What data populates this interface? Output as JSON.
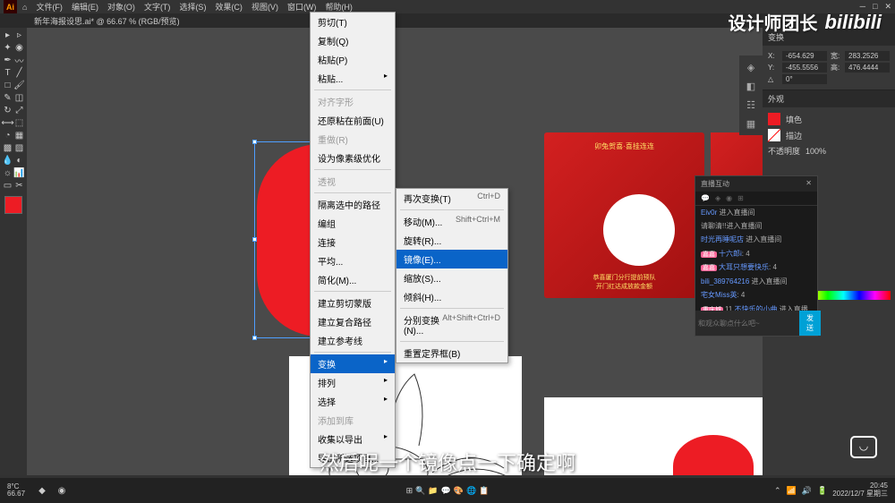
{
  "topbar": {
    "menus": [
      "文件(F)",
      "编辑(E)",
      "对象(O)",
      "文字(T)",
      "选择(S)",
      "效果(C)",
      "视图(V)",
      "窗口(W)",
      "帮助(H)"
    ]
  },
  "tab": {
    "title": "新年海报设思.ai* @ 66.67 % (RGB/预览)"
  },
  "watermark": {
    "text": "设计师团长",
    "logo": "bilibili"
  },
  "context_menu": {
    "items": [
      {
        "label": "剪切(T)"
      },
      {
        "label": "复制(Q)"
      },
      {
        "label": "粘贴(P)"
      },
      {
        "label": "粘贴...",
        "arrow": true
      },
      {
        "sep": true
      },
      {
        "label": "对齐字形",
        "disabled": true
      },
      {
        "label": "还原粘在前面(U)"
      },
      {
        "label": "重做(R)",
        "disabled": true
      },
      {
        "label": "设为像素级优化"
      },
      {
        "sep": true
      },
      {
        "label": "透视",
        "disabled": true
      },
      {
        "sep": true
      },
      {
        "label": "隔离选中的路径"
      },
      {
        "label": "编组"
      },
      {
        "label": "连接"
      },
      {
        "label": "平均..."
      },
      {
        "label": "简化(M)..."
      },
      {
        "sep": true
      },
      {
        "label": "建立剪切蒙版"
      },
      {
        "label": "建立复合路径"
      },
      {
        "label": "建立参考线"
      },
      {
        "sep": true
      },
      {
        "label": "变换",
        "arrow": true,
        "highlight": true
      },
      {
        "label": "排列",
        "arrow": true
      },
      {
        "label": "选择",
        "arrow": true
      },
      {
        "label": "添加到库",
        "disabled": true
      },
      {
        "label": "收集以导出",
        "arrow": true
      },
      {
        "label": "导出所选项目..."
      }
    ]
  },
  "submenu": {
    "items": [
      {
        "label": "再次变换(T)",
        "shortcut": "Ctrl+D"
      },
      {
        "sep": true
      },
      {
        "label": "移动(M)...",
        "shortcut": "Shift+Ctrl+M"
      },
      {
        "label": "旋转(R)..."
      },
      {
        "label": "镜像(E)...",
        "highlight": true
      },
      {
        "label": "缩放(S)..."
      },
      {
        "label": "倾斜(H)..."
      },
      {
        "sep": true
      },
      {
        "label": "分别变换(N)...",
        "shortcut": "Alt+Shift+Ctrl+D"
      },
      {
        "sep": true
      },
      {
        "label": "重置定界框(B)"
      }
    ]
  },
  "transform": {
    "title": "变换",
    "x": "-654.629",
    "y": "283.2526",
    "w": "-455.5556",
    "h": "476.4444",
    "angle": "0°"
  },
  "appearance": {
    "title": "外观",
    "fill": "填色",
    "stroke": "描边",
    "opacity_label": "不透明度",
    "opacity_value": "100%"
  },
  "livechat": {
    "title": "直播互动",
    "msg1_user": "Eiv0r",
    "msg1_text": "进入直播间",
    "msg2": "请聊清!!进入直播间",
    "msg3_user": "时光再睡呢店",
    "msg3_text": "进入直播间",
    "msg4_user": "十六郎i",
    "msg4_badge": "嘉嘉",
    "msg4_text": "4",
    "msg5_user": "大耳只想要快乐",
    "msg5_badge": "嘉嘉",
    "msg5_text": "4",
    "msg6_user": "bili_389764216",
    "msg6_text": "进入直播间",
    "msg7_user": "宅女Miss英",
    "msg7_text": "4",
    "msg8_badge": "重庆城",
    "msg8_num": "11",
    "msg8_user": "不快乐的小曲",
    "msg8_text": "进入直播间",
    "placeholder": "和观众聊点什么吧~",
    "send": "发送"
  },
  "ref_img": {
    "top_text": "卯兔贺喜·喜挂连连",
    "bottom_text1": "恭喜厦门分行提前预队",
    "bottom_text2": "开门红达成放款金额"
  },
  "subtitle": "然后呢一个镜像点一下确定啊",
  "taskbar": {
    "temp": "8°C",
    "temp_label": "66.67",
    "time": "20:45",
    "date": "2022/12/7 星期三"
  }
}
